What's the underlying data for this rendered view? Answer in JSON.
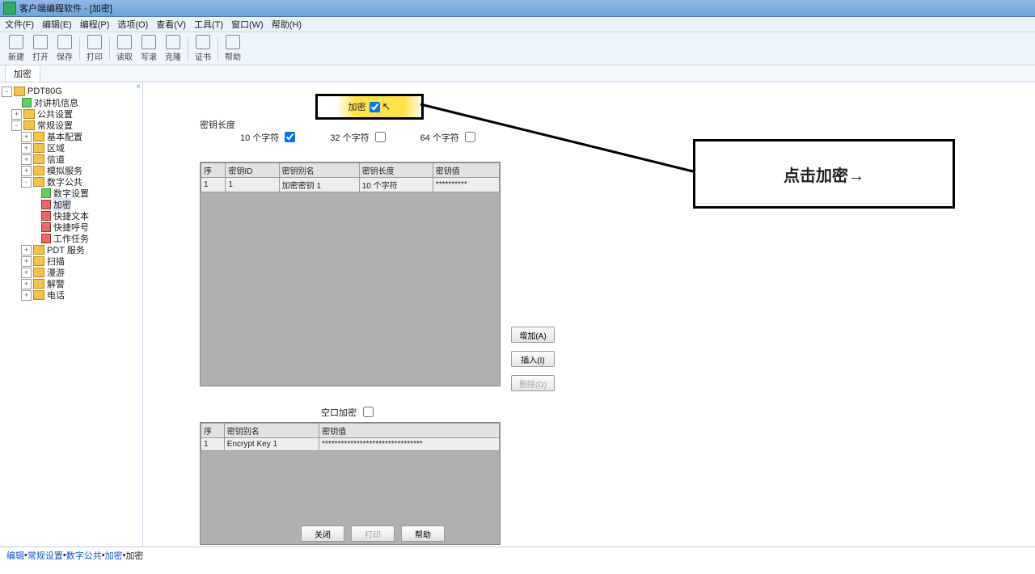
{
  "title": "客户端编程软件 - [加密]",
  "menu": [
    "文件(F)",
    "编辑(E)",
    "编程(P)",
    "选项(O)",
    "查看(V)",
    "工具(T)",
    "窗口(W)",
    "帮助(H)"
  ],
  "toolbar": [
    {
      "label": "新建"
    },
    {
      "label": "打开"
    },
    {
      "label": "保存"
    },
    {
      "sep": true
    },
    {
      "label": "打印"
    },
    {
      "sep": true
    },
    {
      "label": "读取"
    },
    {
      "label": "写滚"
    },
    {
      "label": "克隆"
    },
    {
      "sep": true
    },
    {
      "label": "证书"
    },
    {
      "sep": true
    },
    {
      "label": "帮助"
    }
  ],
  "tab_active": "加密",
  "tree": [
    {
      "lvl": 0,
      "exp": "-",
      "icon": "f",
      "label": "PDT80G"
    },
    {
      "lvl": 1,
      "exp": "",
      "icon": "l-green",
      "label": "对讲机信息"
    },
    {
      "lvl": 1,
      "exp": "+",
      "icon": "f",
      "label": "公共设置"
    },
    {
      "lvl": 1,
      "exp": "-",
      "icon": "f",
      "label": "常规设置"
    },
    {
      "lvl": 2,
      "exp": "+",
      "icon": "f",
      "label": "基本配置"
    },
    {
      "lvl": 2,
      "exp": "+",
      "icon": "f",
      "label": "区域"
    },
    {
      "lvl": 2,
      "exp": "+",
      "icon": "f",
      "label": "信道"
    },
    {
      "lvl": 2,
      "exp": "+",
      "icon": "f",
      "label": "模拟服务"
    },
    {
      "lvl": 2,
      "exp": "-",
      "icon": "f",
      "label": "数字公共"
    },
    {
      "lvl": 3,
      "exp": "",
      "icon": "l-green",
      "label": "数字设置"
    },
    {
      "lvl": 3,
      "exp": "",
      "icon": "l-red",
      "label": "加密",
      "sel": true
    },
    {
      "lvl": 3,
      "exp": "",
      "icon": "l-red",
      "label": "快捷文本"
    },
    {
      "lvl": 3,
      "exp": "",
      "icon": "l-red",
      "label": "快捷呼号"
    },
    {
      "lvl": 3,
      "exp": "",
      "icon": "l-red",
      "label": "工作任务"
    },
    {
      "lvl": 2,
      "exp": "+",
      "icon": "f",
      "label": "PDT 服务"
    },
    {
      "lvl": 2,
      "exp": "+",
      "icon": "f",
      "label": "扫描"
    },
    {
      "lvl": 2,
      "exp": "+",
      "icon": "f",
      "label": "漫游"
    },
    {
      "lvl": 2,
      "exp": "+",
      "icon": "f",
      "label": "解警"
    },
    {
      "lvl": 2,
      "exp": "+",
      "icon": "f",
      "label": "电话"
    }
  ],
  "panel": {
    "key_length_label": "密钥长度",
    "encrypt_checkbox": "加密",
    "opt10": "10 个字符",
    "opt32": "32 个字符",
    "opt64": "64 个字符",
    "grid1": {
      "headers": [
        "序",
        "密钥ID",
        "密钥别名",
        "密钥长度",
        "密钥值"
      ],
      "rows": [
        [
          "1",
          "1",
          "加密密钥 1",
          "10 个字符",
          "**********"
        ]
      ]
    },
    "btn_add": "增加(A)",
    "btn_insert": "插入(I)",
    "btn_delete": "删除(D)",
    "air_encrypt": "空口加密",
    "grid2": {
      "headers": [
        "序",
        "密钥别名",
        "密钥值"
      ],
      "rows": [
        [
          "1",
          "Encrypt Key 1",
          "********************************"
        ]
      ]
    }
  },
  "bottom": {
    "close": "关闭",
    "print": "打印",
    "help": "帮助"
  },
  "status": {
    "p1": "编辑",
    "p2": "常规设置",
    "p3": "数字公共",
    "p4": "加密",
    "p5": "加密"
  },
  "callout": "点击加密→"
}
